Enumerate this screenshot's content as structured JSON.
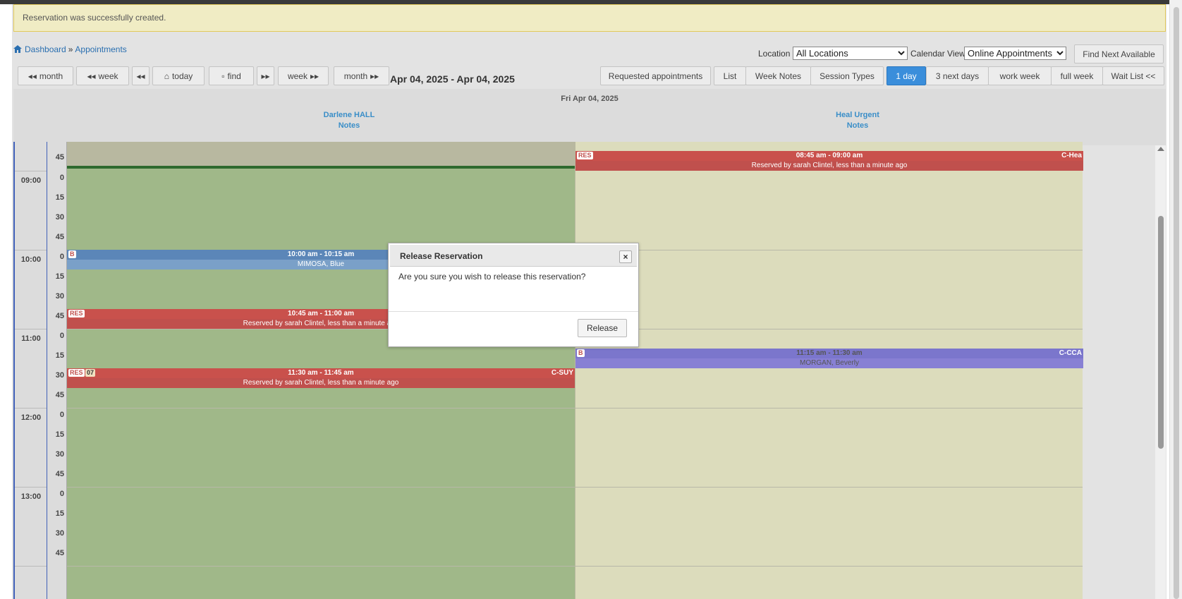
{
  "alert": {
    "message": "Reservation was successfully created."
  },
  "breadcrumb": {
    "home": "Dashboard",
    "separator": "»",
    "current": "Appointments"
  },
  "filters": {
    "location_label": "Location",
    "location_value": "All Locations",
    "calendar_view_label": "Calendar View",
    "calendar_view_value": "Online Appointments",
    "find_next": "Find Next Available"
  },
  "nav": {
    "prev_month": "month",
    "prev_week": "week",
    "prev": "◂◂",
    "today": "today",
    "find": "find",
    "next": "▸▸",
    "next_week": "week",
    "next_month": "month",
    "date_range": "Apr 04, 2025 - Apr 04, 2025"
  },
  "views": {
    "requested": "Requested appointments",
    "list": "List",
    "week_notes": "Week Notes",
    "session_types": "Session Types",
    "one_day": "1 day",
    "three_days": "3 next days",
    "work_week": "work week",
    "full_week": "full week",
    "wait_list": "Wait List <<"
  },
  "day": {
    "title": "Fri Apr 04, 2025",
    "providers": [
      {
        "name": "Darlene HALL",
        "notes": "Notes"
      },
      {
        "name": "Heal Urgent",
        "notes": "Notes"
      }
    ]
  },
  "time_grid": {
    "hours": [
      "09:00",
      "10:00",
      "11:00",
      "12:00",
      "13:00"
    ],
    "minutes": [
      "45",
      "0",
      "15",
      "30",
      "45",
      "0",
      "15",
      "30",
      "45",
      "0",
      "15",
      "30",
      "45",
      "0",
      "15",
      "30",
      "45",
      "0",
      "15",
      "30",
      "45"
    ]
  },
  "appointments": {
    "a1": {
      "tag": "B",
      "time": "10:00 am - 10:15 am",
      "detail": "MIMOSA, Blue"
    },
    "a2": {
      "tag": "RES",
      "time": "10:45 am - 11:00 am",
      "detail": "Reserved by sarah Clintel, less than a minute ago"
    },
    "a3": {
      "tag": "RES",
      "tag2": "07",
      "time": "11:30 am - 11:45 am",
      "code": "C-SUY",
      "detail": "Reserved by sarah Clintel, less than a minute ago"
    },
    "a4": {
      "tag": "RES",
      "time": "08:45 am - 09:00 am",
      "code": "C-Hea",
      "detail": "Reserved by sarah Clintel, less than a minute ago"
    },
    "a5": {
      "tag": "B",
      "time": "11:15 am - 11:30 am",
      "code": "C-CCA",
      "detail": "MORGAN, Beverly"
    }
  },
  "dialog": {
    "title": "Release Reservation",
    "close": "×",
    "message": "Are you sure you wish to release this reservation?",
    "confirm": "Release"
  },
  "colors": {
    "accent": "#3a8edb",
    "reservation": "#c0504d",
    "provider1_bg": "#a0b889",
    "provider2_bg": "#dcdcbc"
  }
}
